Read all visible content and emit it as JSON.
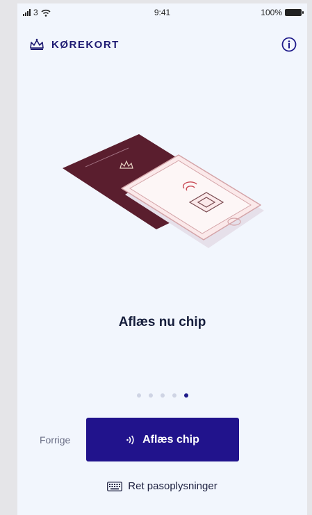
{
  "status_bar": {
    "carrier": "3",
    "time": "9:41",
    "battery": "100%"
  },
  "header": {
    "brand": "KØREKORT",
    "crown_icon": "crown-icon",
    "info_icon": "info-icon"
  },
  "illustration": {
    "description_icon": "passport-phone-illustration"
  },
  "main": {
    "title": "Aflæs nu chip"
  },
  "pager": {
    "total": 5,
    "active_index": 4
  },
  "actions": {
    "previous_label": "Forrige",
    "read_chip_label": "Aflæs chip",
    "edit_passport_label": "Ret pasoplysninger"
  },
  "colors": {
    "primary": "#21138c",
    "background": "#f2f6fd",
    "passport": "#5a1e2e"
  }
}
